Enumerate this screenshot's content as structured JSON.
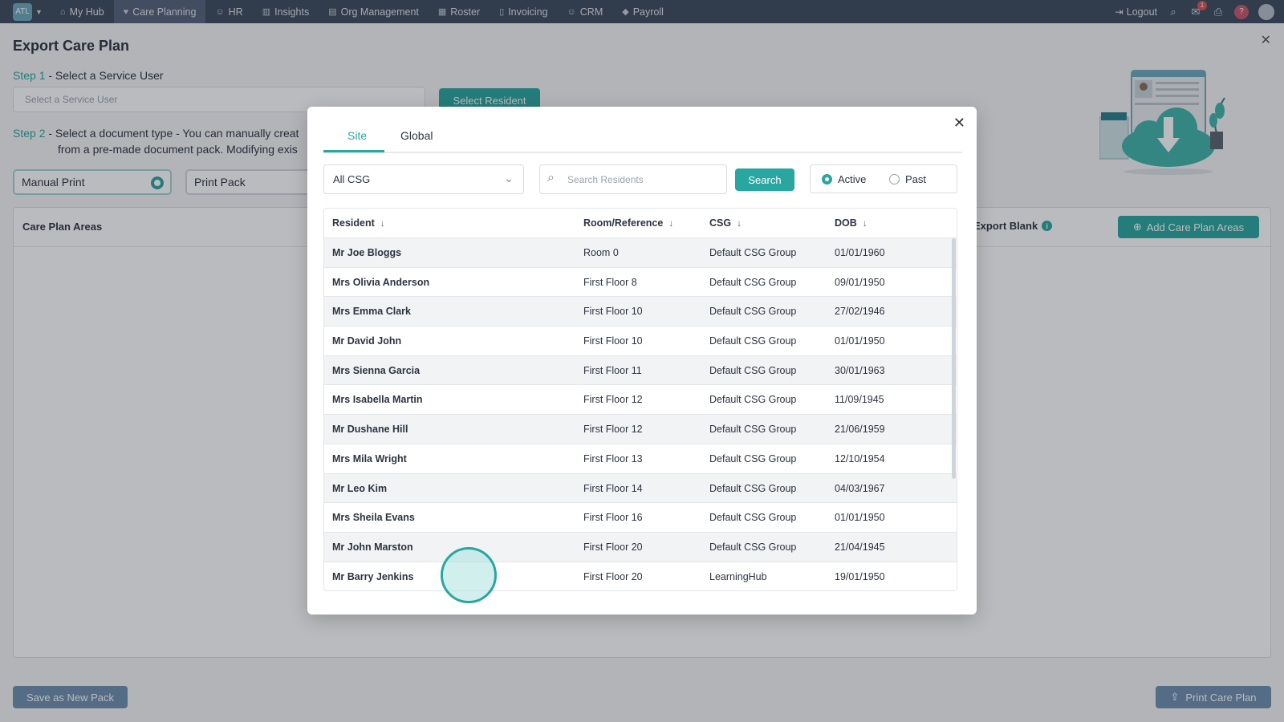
{
  "topnav": {
    "logo_text": "ATL",
    "items": [
      {
        "label": "My Hub",
        "icon": "home-icon"
      },
      {
        "label": "Care Planning",
        "icon": "heart-icon"
      },
      {
        "label": "HR",
        "icon": "people-icon"
      },
      {
        "label": "Insights",
        "icon": "chart-icon"
      },
      {
        "label": "Org Management",
        "icon": "building-icon"
      },
      {
        "label": "Roster",
        "icon": "calendar-icon"
      },
      {
        "label": "Invoicing",
        "icon": "document-icon"
      },
      {
        "label": "CRM",
        "icon": "contacts-icon"
      },
      {
        "label": "Payroll",
        "icon": "payroll-icon"
      }
    ],
    "logout_label": "Logout",
    "mail_badge": "1",
    "help_label": "?"
  },
  "page": {
    "title": "Export Care Plan",
    "step1_num": "Step 1",
    "step1_text": " - Select a Service User",
    "service_user_placeholder": "Select a Service User",
    "select_resident_label": "Select Resident",
    "step2_num": "Step 2",
    "step2_line1": " - Select a document type - You can manually creat",
    "step2_line2": "from a pre-made document pack. Modifying exis",
    "manual_print_label": "Manual Print",
    "print_pack_label": "Print Pack",
    "areas_title": "Care Plan Areas",
    "export_blank_label": "Export Blank",
    "add_areas_label": "Add Care Plan Areas",
    "save_pack_label": "Save as New Pack",
    "print_label": "Print Care Plan"
  },
  "modal": {
    "tabs": [
      "Site",
      "Global"
    ],
    "active_tab": "Site",
    "csg_value": "All CSG",
    "search_placeholder": "Search Residents",
    "search_label": "Search",
    "status_options": [
      "Active",
      "Past"
    ],
    "status_selected": "Active",
    "columns": [
      "Resident",
      "Room/Reference",
      "CSG",
      "DOB"
    ],
    "rows": [
      {
        "name": "Mr Joe Bloggs",
        "room": "Room 0",
        "csg": "Default CSG Group",
        "dob": "01/01/1960"
      },
      {
        "name": "Mrs Olivia Anderson",
        "room": "First Floor 8",
        "csg": "Default CSG Group",
        "dob": "09/01/1950"
      },
      {
        "name": "Mrs Emma Clark",
        "room": "First Floor 10",
        "csg": "Default CSG Group",
        "dob": "27/02/1946"
      },
      {
        "name": "Mr David John",
        "room": "First Floor 10",
        "csg": "Default CSG Group",
        "dob": "01/01/1950"
      },
      {
        "name": "Mrs Sienna Garcia",
        "room": "First Floor 11",
        "csg": "Default CSG Group",
        "dob": "30/01/1963"
      },
      {
        "name": "Mrs Isabella Martin",
        "room": "First Floor 12",
        "csg": "Default CSG Group",
        "dob": "11/09/1945"
      },
      {
        "name": "Mr Dushane Hill",
        "room": "First Floor 12",
        "csg": "Default CSG Group",
        "dob": "21/06/1959"
      },
      {
        "name": "Mrs Mila Wright",
        "room": "First Floor 13",
        "csg": "Default CSG Group",
        "dob": "12/10/1954"
      },
      {
        "name": "Mr Leo Kim",
        "room": "First Floor 14",
        "csg": "Default CSG Group",
        "dob": "04/03/1967"
      },
      {
        "name": "Mrs Sheila Evans",
        "room": "First Floor 16",
        "csg": "Default CSG Group",
        "dob": "01/01/1950"
      },
      {
        "name": "Mr John Marston",
        "room": "First Floor 20",
        "csg": "Default CSG Group",
        "dob": "21/04/1945"
      },
      {
        "name": "Mr Barry Jenkins",
        "room": "First Floor 20",
        "csg": "LearningHub",
        "dob": "19/01/1950"
      }
    ]
  },
  "colors": {
    "accent": "#2aa6a0",
    "nav_bg": "#3c4a5c",
    "muted_button": "#6d8fae"
  }
}
